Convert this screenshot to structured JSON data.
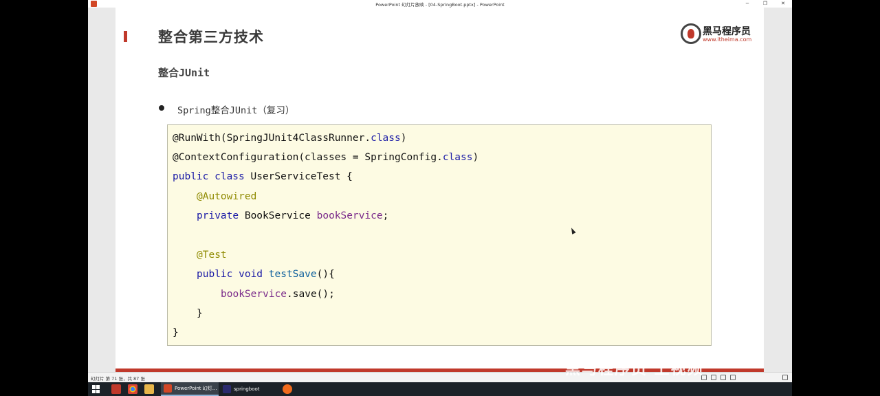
{
  "window": {
    "title": "PowerPoint 幻灯片放映 - [04-SpringBoot.pptx] - PowerPoint",
    "minimize_glyph": "−",
    "maximize_glyph": "❐",
    "close_glyph": "✕"
  },
  "slide": {
    "title": "整合第三方技术",
    "subtitle": "整合JUnit",
    "bullet": "Spring整合JUnit（复习）",
    "logo": {
      "brand": "黑马程序员",
      "url": "www.itheima.com"
    },
    "code": {
      "l1_a": "@RunWith(SpringJUnit4ClassRunner.",
      "l1_b": "class",
      "l1_c": ")",
      "l2_a": "@ContextConfiguration(classes = SpringConfig.",
      "l2_b": "class",
      "l2_c": ")",
      "l3_a": "public class",
      "l3_b": " UserServiceTest {",
      "l4": "@Autowired",
      "l5_a": "private",
      "l5_b": " BookService ",
      "l5_c": "bookService",
      "l5_d": ";",
      "l7": "@Test",
      "l8_a": "public void",
      "l8_b": " ",
      "l8_c": "testSave",
      "l8_d": "(){",
      "l9_a": "bookService",
      "l9_b": ".save();",
      "l10": "}",
      "l11": "}"
    }
  },
  "statusbar": {
    "slide_info": "幻灯片 第 71 张，共 87 张"
  },
  "watermark": "黑马程序员 上视频",
  "taskbar": {
    "apps": [
      {
        "label": "PowerPoint 幻灯..."
      },
      {
        "label": "springboot"
      }
    ]
  },
  "colors": {
    "accent": "#c0392b",
    "code_background": "#fdfbe3",
    "keyword": "#1a1aa6",
    "annotation": "#8f8a00",
    "field": "#7a2a8a"
  }
}
